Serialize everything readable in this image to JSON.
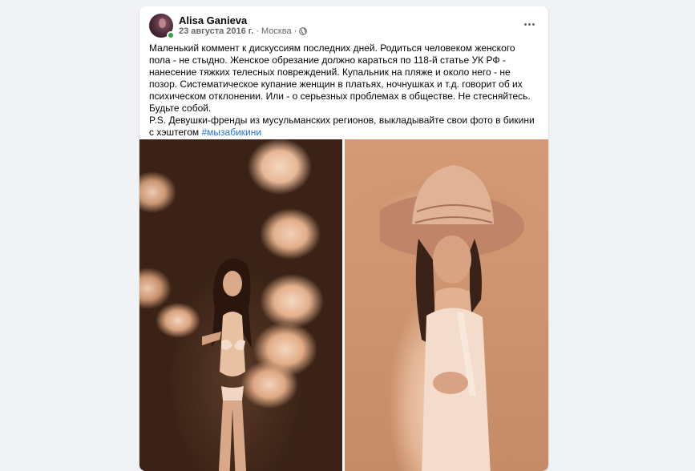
{
  "post": {
    "author": "Alisa Ganieva",
    "date": "23 августа 2016 г.",
    "separator": "·",
    "location": "Москва",
    "separator2": "·",
    "privacy_icon": "globe-icon",
    "more_icon": "more-horizontal-icon",
    "text_lines": [
      "Маленький коммент к дискуссиям последних дней. Родиться человеком женского",
      "пола - не стыдно. Женское обрезание должно караться по 118-й статье УК РФ -",
      "нанесение тяжких телесных повреждений. Купальник на пляже и около него - не",
      "позор. Систематическое купание женщин в платьях, ночнушках и т.д. говорит об их",
      "психическом отклонении. Или - о серьезных проблемах в обществе. Не стесняйтесь.",
      "Будьте собой.",
      "P.S. Девушки-френды из мусульманских регионов, выкладывайте свои фото в бикини"
    ],
    "last_line_prefix": "с хэштегом ",
    "hashtag": "#мызабикини"
  },
  "colors": {
    "accent_link": "#216fdb",
    "online_status": "#31a24c",
    "secondary_text": "#65676b"
  },
  "photos": [
    {
      "description_name": "photo-woman-flowers"
    },
    {
      "description_name": "photo-woman-hat"
    }
  ]
}
